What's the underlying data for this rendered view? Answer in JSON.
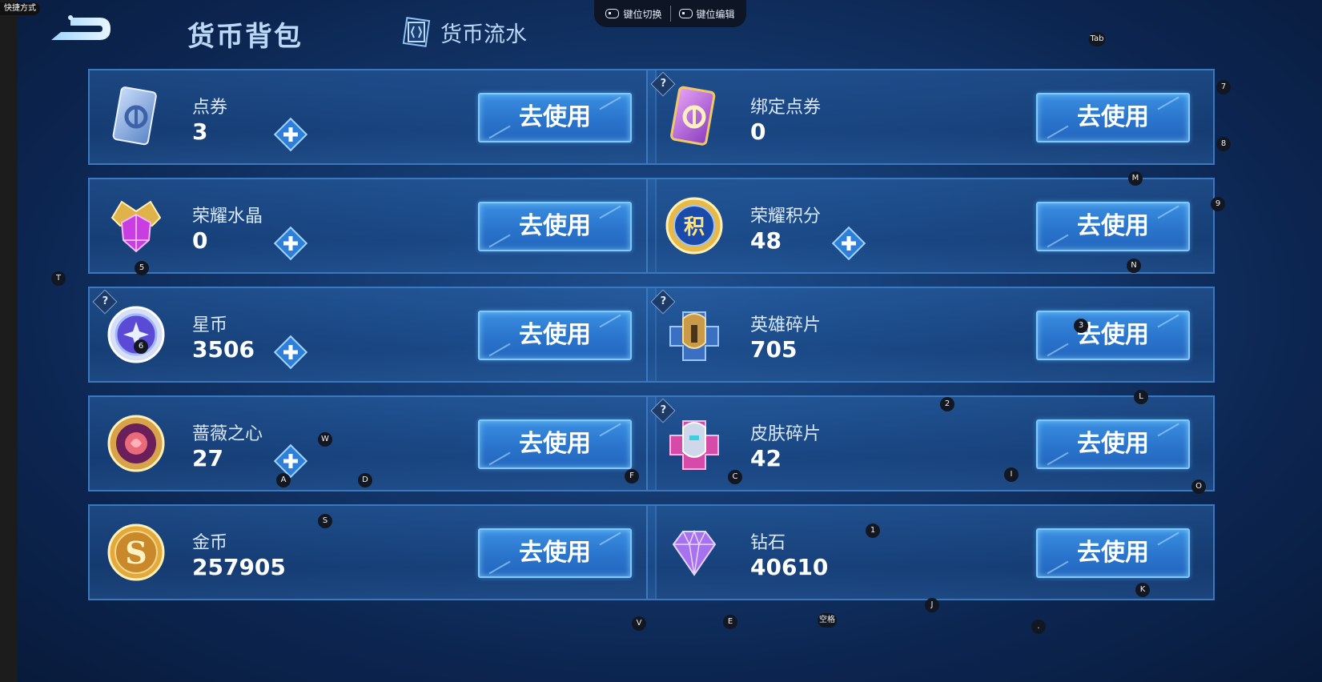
{
  "shortcut_label": "快捷方式",
  "header": {
    "title": "货币背包",
    "flow_tab_label": "货币流水"
  },
  "keymap_bar": {
    "switch_label": "键位切换",
    "edit_label": "键位编辑"
  },
  "cards": [
    {
      "name": "点券",
      "amount": "3",
      "icon": "voucher-icon",
      "has_plus": true,
      "has_help": false,
      "button": "去使用"
    },
    {
      "name": "绑定点券",
      "amount": "0",
      "icon": "bound-voucher-icon",
      "has_plus": false,
      "has_help": true,
      "button": "去使用"
    },
    {
      "name": "荣耀水晶",
      "amount": "0",
      "icon": "glory-crystal-icon",
      "has_plus": true,
      "has_help": false,
      "button": "去使用"
    },
    {
      "name": "荣耀积分",
      "amount": "48",
      "icon": "glory-points-icon",
      "has_plus": true,
      "has_help": false,
      "button": "去使用"
    },
    {
      "name": "星币",
      "amount": "3506",
      "icon": "star-coin-icon",
      "has_plus": true,
      "has_help": true,
      "button": "去使用"
    },
    {
      "name": "英雄碎片",
      "amount": "705",
      "icon": "hero-shard-icon",
      "has_plus": false,
      "has_help": true,
      "button": "去使用"
    },
    {
      "name": "蔷薇之心",
      "amount": "27",
      "icon": "rose-heart-icon",
      "has_plus": true,
      "has_help": false,
      "button": "去使用"
    },
    {
      "name": "皮肤碎片",
      "amount": "42",
      "icon": "skin-shard-icon",
      "has_plus": false,
      "has_help": true,
      "button": "去使用"
    },
    {
      "name": "金币",
      "amount": "257905",
      "icon": "gold-coin-icon",
      "has_plus": false,
      "has_help": false,
      "button": "去使用"
    },
    {
      "name": "钻石",
      "amount": "40610",
      "icon": "diamond-icon",
      "has_plus": false,
      "has_help": false,
      "button": "去使用"
    }
  ],
  "key_labels": [
    "Tab",
    "7",
    "8",
    "M",
    "9",
    "N",
    "T",
    "5",
    "6",
    "3",
    "2",
    "L",
    "W",
    "A",
    "D",
    "F",
    "C",
    "I",
    "O",
    "S",
    "1",
    "K",
    "J",
    "V",
    "E",
    "空格",
    "."
  ],
  "colors": {
    "background": "#143a70",
    "card_border": "#3a79bf",
    "button": "#2a74cc",
    "button_border": "#7ec9ff",
    "text_light": "#d9e8fa"
  }
}
